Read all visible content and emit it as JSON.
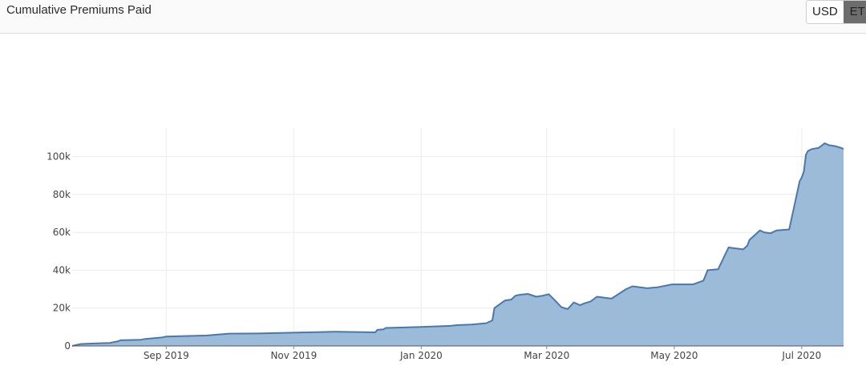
{
  "header": {
    "title": "Cumulative Premiums Paid",
    "currency_options": [
      {
        "label": "USD",
        "active": true
      },
      {
        "label": "ETH",
        "active": false
      }
    ]
  },
  "chart_data": {
    "type": "area",
    "title": "Cumulative Premiums Paid",
    "xlabel": "",
    "ylabel": "",
    "x_range": [
      "2019-07-18",
      "2020-07-21"
    ],
    "ylim": [
      0,
      115000
    ],
    "x_ticks": [
      {
        "date": "2019-09-01",
        "label": "Sep 2019"
      },
      {
        "date": "2019-11-01",
        "label": "Nov 2019"
      },
      {
        "date": "2020-01-01",
        "label": "Jan 2020"
      },
      {
        "date": "2020-03-01",
        "label": "Mar 2020"
      },
      {
        "date": "2020-05-01",
        "label": "May 2020"
      },
      {
        "date": "2020-07-01",
        "label": "Jul 2020"
      }
    ],
    "y_ticks": [
      {
        "value": 0,
        "label": "0"
      },
      {
        "value": 20000,
        "label": "20k"
      },
      {
        "value": 40000,
        "label": "40k"
      },
      {
        "value": 60000,
        "label": "60k"
      },
      {
        "value": 80000,
        "label": "80k"
      },
      {
        "value": 100000,
        "label": "100k"
      }
    ],
    "grid": true,
    "colors": {
      "fill": "#9bbbd9",
      "line": "#4a78ad",
      "grid": "#ececec"
    },
    "series": [
      {
        "x": [
          "2019-07-18",
          "2019-07-22",
          "2019-07-25",
          "2019-08-05",
          "2019-08-09",
          "2019-08-10",
          "2019-08-20",
          "2019-08-22",
          "2019-08-30",
          "2019-09-01",
          "2019-09-20",
          "2019-10-01",
          "2019-10-15",
          "2019-11-01",
          "2019-11-20",
          "2019-11-22",
          "2019-12-10",
          "2019-12-11",
          "2019-12-14",
          "2019-12-15",
          "2020-01-01",
          "2020-01-15",
          "2020-01-18",
          "2020-01-25",
          "2020-02-01",
          "2020-02-04",
          "2020-02-05",
          "2020-02-10",
          "2020-02-13",
          "2020-02-15",
          "2020-02-17",
          "2020-02-21",
          "2020-02-25",
          "2020-02-28",
          "2020-03-02",
          "2020-03-05",
          "2020-03-08",
          "2020-03-11",
          "2020-03-14",
          "2020-03-17",
          "2020-03-19",
          "2020-03-22",
          "2020-03-25",
          "2020-04-01",
          "2020-04-08",
          "2020-04-11",
          "2020-04-18",
          "2020-04-23",
          "2020-04-30",
          "2020-05-10",
          "2020-05-15",
          "2020-05-17",
          "2020-05-22",
          "2020-05-27",
          "2020-06-03",
          "2020-06-05",
          "2020-06-06",
          "2020-06-11",
          "2020-06-13",
          "2020-06-16",
          "2020-06-19",
          "2020-06-25",
          "2020-06-30",
          "2020-07-01",
          "2020-07-02",
          "2020-07-03",
          "2020-07-04",
          "2020-07-06",
          "2020-07-09",
          "2020-07-12",
          "2020-07-14",
          "2020-07-17",
          "2020-07-20",
          "2020-07-21"
        ],
        "y": [
          0,
          1000,
          1200,
          1600,
          2500,
          3000,
          3300,
          3700,
          4500,
          5000,
          5500,
          6500,
          6600,
          7000,
          7500,
          7500,
          7200,
          8500,
          8800,
          9500,
          10000,
          10600,
          11000,
          11300,
          12000,
          13500,
          20000,
          24000,
          24500,
          26500,
          27000,
          27500,
          26000,
          26500,
          27300,
          24000,
          20500,
          19500,
          23000,
          21500,
          22500,
          23500,
          26000,
          25000,
          30000,
          31500,
          30500,
          31000,
          32500,
          32500,
          34500,
          40000,
          40500,
          52000,
          51000,
          53000,
          56000,
          61000,
          60000,
          59500,
          61000,
          61500,
          87000,
          89000,
          92000,
          101000,
          103000,
          104000,
          104500,
          107000,
          106000,
          105500,
          104500,
          104000
        ]
      }
    ]
  }
}
